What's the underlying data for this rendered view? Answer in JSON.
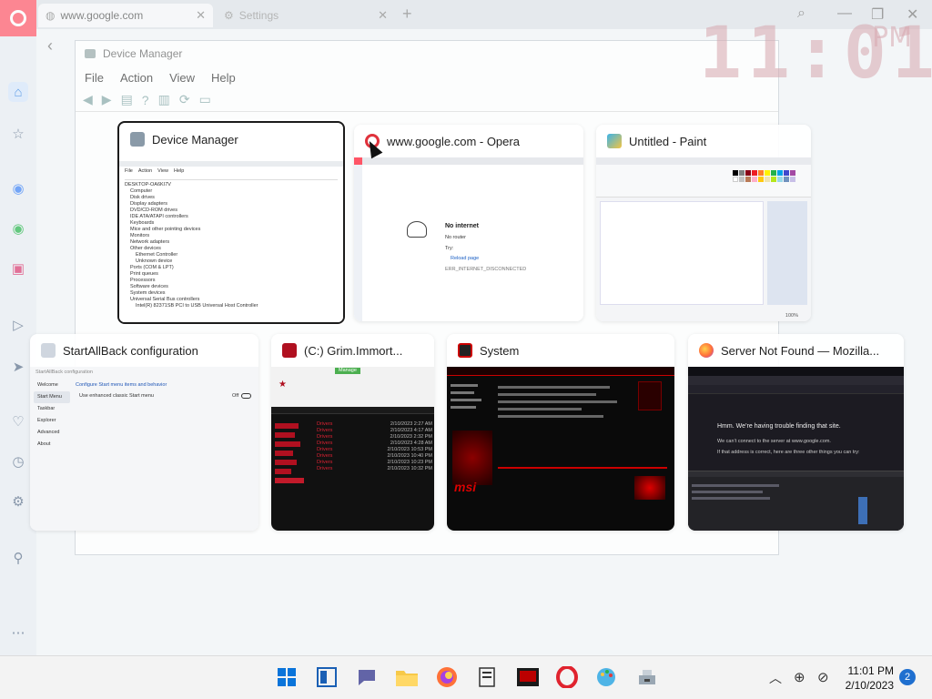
{
  "browser": {
    "tabs": [
      {
        "label": "www.google.com",
        "icon": "globe-icon"
      },
      {
        "label": "Settings",
        "icon": "gear-icon"
      }
    ],
    "accent": "#ff5566"
  },
  "background_window": {
    "title": "Device Manager",
    "menu": [
      "File",
      "Action",
      "View",
      "Help"
    ]
  },
  "big_clock": {
    "time": "11:01",
    "ampm": "PM"
  },
  "switcher": {
    "windows": [
      {
        "title": "Device Manager",
        "icon": "device-manager-icon",
        "selected": true
      },
      {
        "title": "www.google.com - Opera",
        "icon": "opera-icon",
        "selected": false
      },
      {
        "title": "Untitled - Paint",
        "icon": "paint-icon",
        "selected": false
      },
      {
        "title": "StartAllBack configuration",
        "icon": "startallback-icon",
        "selected": false
      },
      {
        "title": "(C:) Grim.Immort...",
        "icon": "file-explorer-icon",
        "selected": false
      },
      {
        "title": "System",
        "icon": "system-icon",
        "selected": false
      },
      {
        "title": "Server Not Found — Mozilla...",
        "icon": "firefox-icon",
        "selected": false
      }
    ],
    "thumbs": {
      "device_manager": {
        "menu": [
          "File",
          "Action",
          "View",
          "Help"
        ],
        "tree": [
          "DESKTOP-OA6KI7V",
          "Computer",
          "Disk drives",
          "Display adapters",
          "DVD/CD-ROM drives",
          "IDE ATA/ATAPI controllers",
          "Keyboards",
          "Mice and other pointing devices",
          "Monitors",
          "Network adapters",
          "Other devices",
          "Ethernet Controller",
          "Unknown device",
          "Ports (COM & LPT)",
          "Print queues",
          "Processors",
          "Software devices",
          "System devices",
          "Universal Serial Bus controllers",
          "Intel(R) 82371SB PCI to USB Universal Host Controller"
        ]
      },
      "opera": {
        "heading": "No internet",
        "line1": "No router",
        "line2": "Try:",
        "line3": "Reload page",
        "code": "ERR_INTERNET_DISCONNECTED"
      },
      "paint": {
        "status": "100%"
      },
      "startallback": {
        "window_title": "StartAllBack configuration",
        "nav": [
          "Welcome",
          "Start Menu",
          "Taskbar",
          "Explorer",
          "Advanced",
          "About"
        ],
        "heading": "Configure Start menu items and behavior",
        "option": "Use enhanced classic Start menu",
        "toggle": "Off"
      },
      "explorer": {
        "ribbon_tab": "Manage",
        "items": [
          "Drivers",
          "Drivers",
          "Drivers",
          "Drivers",
          "Drivers",
          "Drivers",
          "Drivers",
          "Drivers",
          "Drivers"
        ],
        "dates": [
          "2/10/2023 2:27 AM",
          "2/10/2023 4:17 AM",
          "2/10/2023 2:32 PM",
          "2/10/2023 4:28 AM",
          "2/10/2023 10:53 PM",
          "2/10/2023 10:40 PM",
          "2/10/2023 10:23 PM",
          "2/10/2023 10:32 PM"
        ]
      },
      "system": {
        "brand": "msi"
      },
      "firefox": {
        "heading": "Hmm. We’re having trouble finding that site.",
        "line1": "We can’t connect to the server at www.google.com.",
        "line2": "If that address is correct, here are three other things you can try:"
      }
    }
  },
  "taskbar": {
    "apps": [
      "windows-start-icon",
      "snap-layouts-icon",
      "teams-chat-icon",
      "file-explorer-icon",
      "firefox-icon",
      "notepad-icon",
      "msi-center-icon",
      "opera-icon",
      "paint-icon",
      "device-manager-icon"
    ],
    "time": "11:01 PM",
    "date": "2/10/2023",
    "notifications": "2"
  }
}
